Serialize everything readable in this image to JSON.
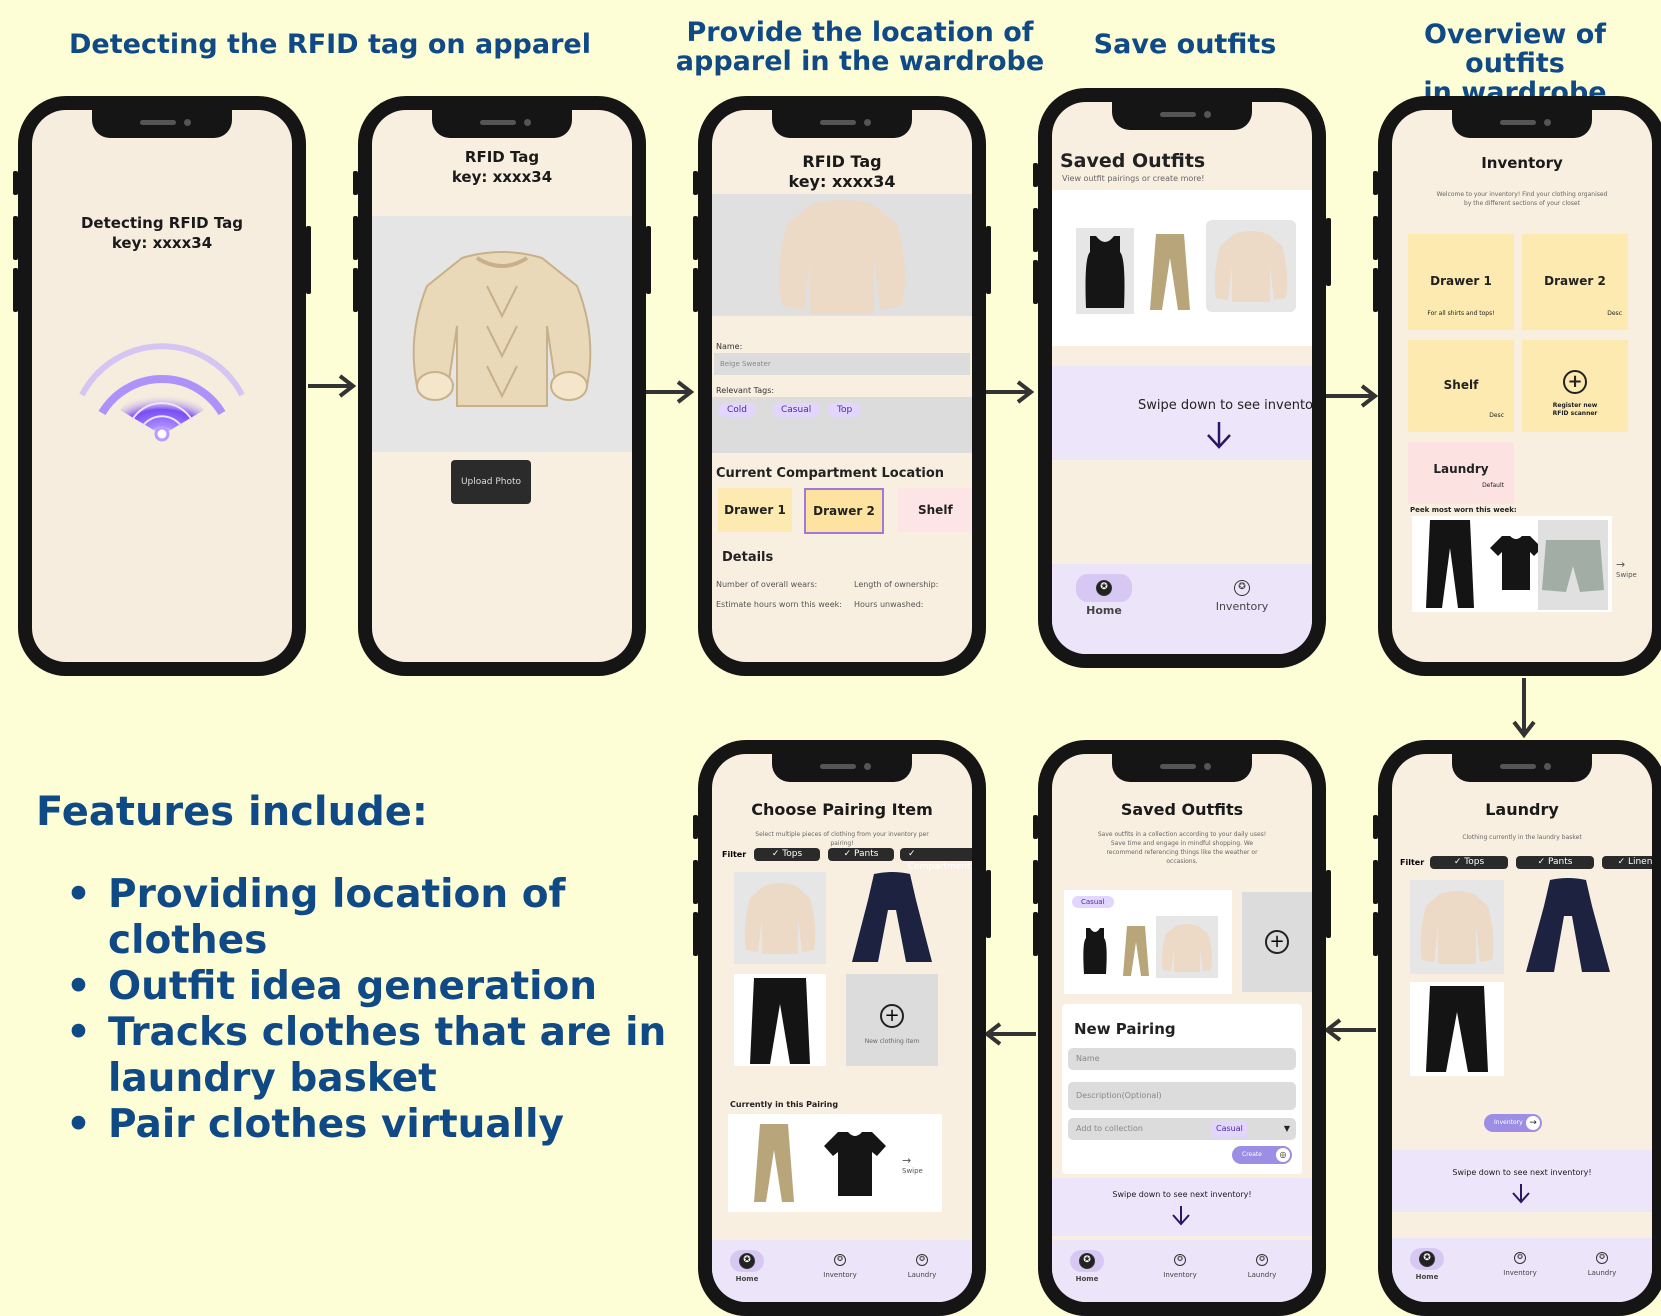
{
  "titles": {
    "t1": "Detecting the RFID tag on apparel",
    "t2_l1": "Provide the location of",
    "t2_l2": "apparel in the wardrobe",
    "t3": "Save outfits",
    "t4_l1": "Overview of outfits",
    "t4_l2": "in wardrobe"
  },
  "features": {
    "heading": "Features include:",
    "items": [
      {
        "l1": "Providing location of",
        "l2": "clothes"
      },
      {
        "l1": "Outfit idea generation",
        "l2": ""
      },
      {
        "l1": "Tracks clothes that are in",
        "l2": "laundry basket"
      },
      {
        "l1": "Pair clothes virtually",
        "l2": ""
      }
    ]
  },
  "phone1": {
    "line1": "Detecting RFID Tag",
    "line2": "key: xxxx34"
  },
  "phone2": {
    "line1": "RFID Tag",
    "line2": "key: xxxx34",
    "upload": "Upload Photo"
  },
  "phone3": {
    "line1": "RFID Tag",
    "line2": "key: xxxx34",
    "name_label": "Name:",
    "name_value": "Beige Sweater",
    "tags_label": "Relevant Tags:",
    "tags": [
      "Cold",
      "Casual",
      "Top"
    ],
    "compartment_heading": "Current Compartment Location",
    "compartments": [
      "Drawer 1",
      "Drawer 2",
      "Shelf"
    ],
    "details_heading": "Details",
    "details": [
      "Number of overall wears:",
      "Length of ownership:",
      "Estimate hours worn this week:",
      "Hours unwashed:"
    ]
  },
  "phone4": {
    "title": "Saved Outfits",
    "subtitle": "View outfit pairings or create more!",
    "swipe": "Swipe down to see inventory!",
    "nav": [
      "Home",
      "Inventory"
    ]
  },
  "phone5": {
    "title": "Inventory",
    "subtitle_l1": "Welcome to your inventory! Find your clothing organised",
    "subtitle_l2": "by the different sections of your closet",
    "tiles": [
      {
        "name": "Drawer 1",
        "desc": "For all shirts and tops!"
      },
      {
        "name": "Drawer 2",
        "desc": "Desc"
      },
      {
        "name": "Shelf",
        "desc": "Desc"
      },
      {
        "name": "Register new RFID scanner",
        "desc": ""
      },
      {
        "name": "Laundry",
        "desc": "Default"
      }
    ],
    "peek": "Peek most worn this week:",
    "swipe": "Swipe"
  },
  "phone6": {
    "title": "Laundry",
    "subtitle": "Clothing currently in the laundry basket",
    "filter": "Filter",
    "chips": [
      "✓ Tops",
      "✓ Pants",
      "✓ Linen"
    ],
    "button": "Inventory",
    "swipe": "Swipe down to see next inventory!",
    "nav": [
      "Home",
      "Inventory",
      "Laundry"
    ]
  },
  "phone7": {
    "title": "Saved Outfits",
    "subtitle_l1": "Save outfits in a collection according to your daily uses!",
    "subtitle_l2": "Save time and engage in mindful shopping. We",
    "subtitle_l3": "recommend referencing things like the weather or",
    "subtitle_l4": "occasions.",
    "collection_tag": "Casual",
    "new_pairing": "New Pairing",
    "name_ph": "Name",
    "desc_ph": "Description(Optional)",
    "add_label": "Add to collection",
    "add_value": "Casual",
    "create": "Create",
    "swipe": "Swipe down to see next inventory!",
    "nav": [
      "Home",
      "Inventory",
      "Laundry"
    ]
  },
  "phone8": {
    "title": "Choose Pairing Item",
    "subtitle_l1": "Select multiple pieces of clothing from your inventory per",
    "subtitle_l2": "pairing!",
    "filter": "Filter",
    "chips": [
      "✓ Tops",
      "✓ Pants",
      "✓ Compartment"
    ],
    "new_item": "New clothing item",
    "current": "Currently in this Pairing",
    "swipe": "Swipe",
    "nav": [
      "Home",
      "Inventory",
      "Laundry"
    ]
  }
}
